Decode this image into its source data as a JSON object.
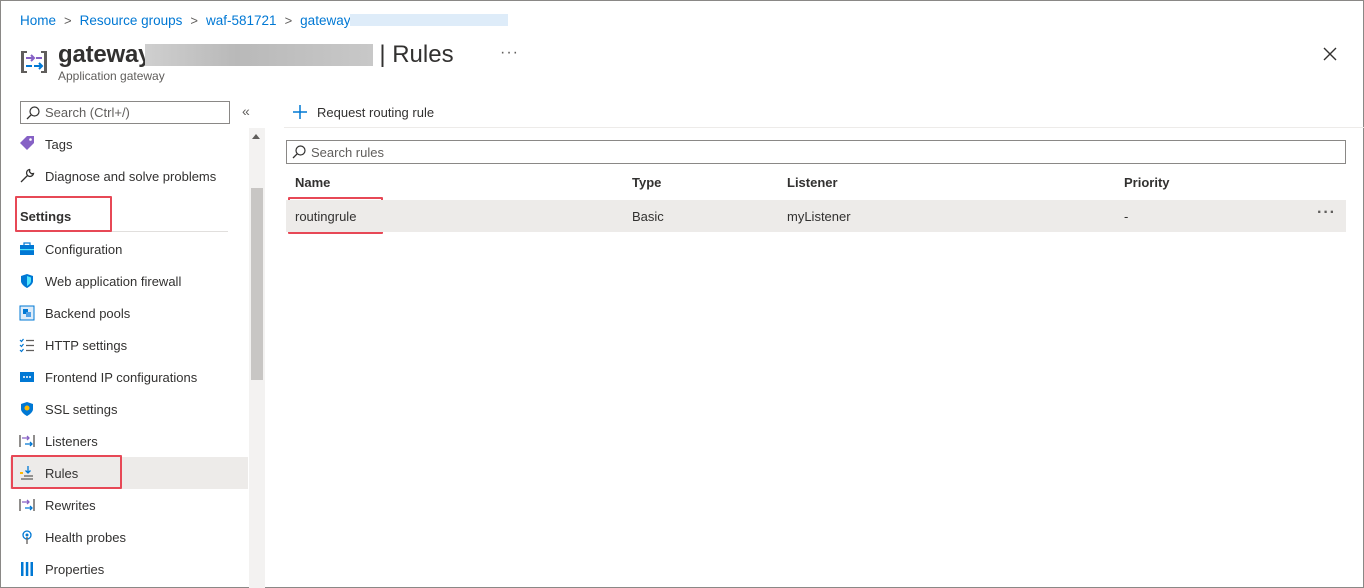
{
  "breadcrumb": {
    "items": [
      "Home",
      "Resource groups",
      "waf-581721",
      "gateway"
    ],
    "separator": ">"
  },
  "header": {
    "title_prefix": "gateway",
    "title_suffix": "| Rules",
    "subtitle": "Application gateway",
    "more_label": "···"
  },
  "sidebar": {
    "search_placeholder": "Search (Ctrl+/)",
    "collapse_label": "«",
    "items_top": [
      {
        "label": "Tags",
        "icon": "tag-icon"
      },
      {
        "label": "Diagnose and solve problems",
        "icon": "wrench-icon"
      }
    ],
    "section_label": "Settings",
    "items": [
      {
        "label": "Configuration",
        "icon": "briefcase-icon"
      },
      {
        "label": "Web application firewall",
        "icon": "shield-icon"
      },
      {
        "label": "Backend pools",
        "icon": "backend-pool-icon"
      },
      {
        "label": "HTTP settings",
        "icon": "checklist-icon"
      },
      {
        "label": "Frontend IP configurations",
        "icon": "frontend-ip-icon"
      },
      {
        "label": "SSL settings",
        "icon": "ssl-shield-icon"
      },
      {
        "label": "Listeners",
        "icon": "listener-icon"
      },
      {
        "label": "Rules",
        "icon": "rules-icon"
      },
      {
        "label": "Rewrites",
        "icon": "rewrite-icon"
      },
      {
        "label": "Health probes",
        "icon": "probe-icon"
      },
      {
        "label": "Properties",
        "icon": "properties-icon"
      }
    ],
    "active_item": "Rules"
  },
  "main": {
    "add_button_label": "Request routing rule",
    "search_placeholder": "Search rules",
    "columns": [
      "Name",
      "Type",
      "Listener",
      "Priority"
    ],
    "rows": [
      {
        "name": "routingrule",
        "type": "Basic",
        "listener": "myListener",
        "priority": "-"
      }
    ],
    "row_more_label": "···"
  },
  "colors": {
    "accent": "#0078d4",
    "highlight_box": "#e74856",
    "active_row": "#edebe9"
  }
}
